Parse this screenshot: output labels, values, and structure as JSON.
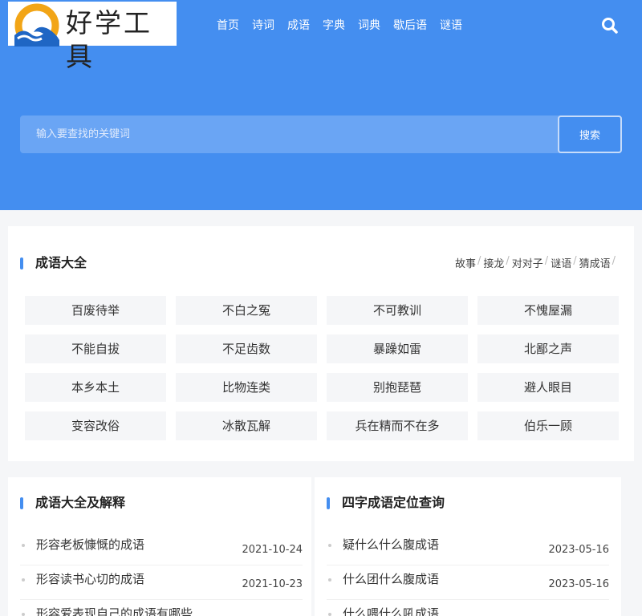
{
  "site": {
    "logo_text": "好学工具"
  },
  "nav": {
    "items": [
      "首页",
      "诗词",
      "成语",
      "字典",
      "词典",
      "歇后语",
      "谜语"
    ]
  },
  "search": {
    "placeholder": "输入要查找的关键词",
    "button_label": "搜索"
  },
  "idioms_section": {
    "title": "成语大全",
    "sublinks": [
      "故事",
      "接龙",
      "对对子",
      "谜语",
      "猜成语"
    ],
    "separator": "/",
    "items": [
      "百废待举",
      "不白之冤",
      "不可教训",
      "不愧屋漏",
      "不能自拔",
      "不足齿数",
      "暴躁如雷",
      "北鄙之声",
      "本乡本土",
      "比物连类",
      "别抱琵琶",
      "避人眼目",
      "变容改俗",
      "冰散瓦解",
      "兵在精而不在多",
      "伯乐一顾"
    ]
  },
  "explanations_section": {
    "title": "成语大全及解释",
    "articles": [
      {
        "title": "形容老板慷慨的成语",
        "date": "2021-10-24"
      },
      {
        "title": "形容读书心切的成语",
        "date": "2021-10-23"
      },
      {
        "title": "形容爱表现自己的成语有哪些",
        "date": ""
      }
    ]
  },
  "position_section": {
    "title": "四字成语定位查询",
    "articles": [
      {
        "title": "疑什么什么腹成语",
        "date": "2023-05-16"
      },
      {
        "title": "什么团什么腹成语",
        "date": "2023-05-16"
      },
      {
        "title": "什么喂什么吼成语",
        "date": ""
      }
    ]
  },
  "colors": {
    "brand": "#448ef0",
    "search_bar": "#6aa5f4",
    "page_bg": "#f5f6f8",
    "chip_bg": "#f5f6f8"
  },
  "icons": [
    "logo-emblem-icon",
    "search-icon"
  ]
}
